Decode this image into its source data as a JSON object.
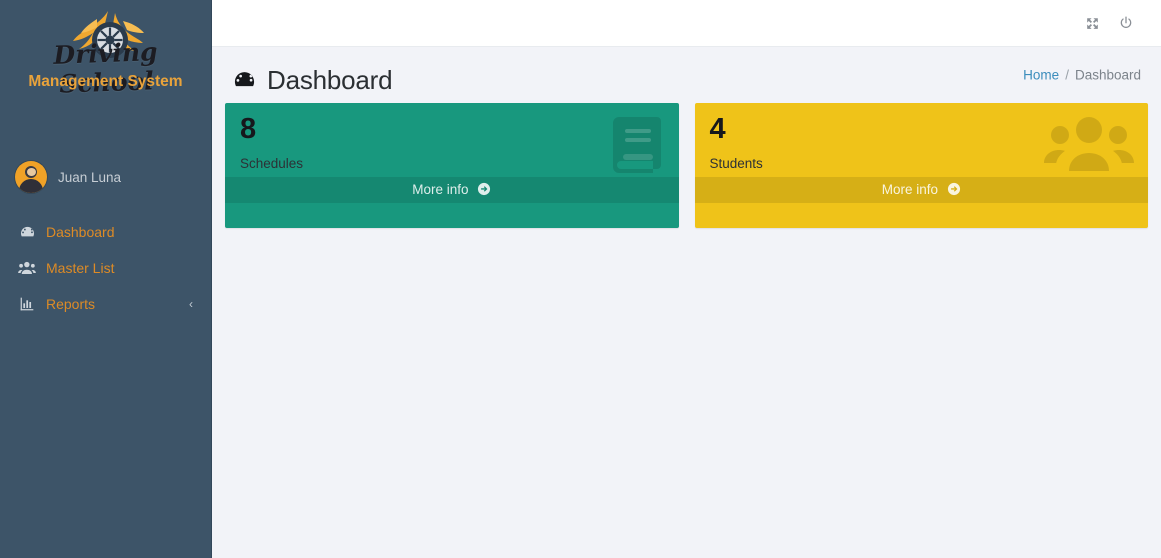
{
  "sidebar": {
    "brand": {
      "script_text": "Driving School",
      "sub_text": "Management System",
      "logo_icon": "flame-wheel-logo-icon"
    },
    "user": {
      "name": "Juan Luna",
      "avatar_icon": "user-avatar"
    },
    "items": [
      {
        "label": "Dashboard",
        "icon": "tachometer-icon",
        "active": true,
        "arrow": ""
      },
      {
        "label": "Master List",
        "icon": "users-icon",
        "active": false,
        "arrow": ""
      },
      {
        "label": "Reports",
        "icon": "chart-bar-icon",
        "active": false,
        "arrow": "‹"
      }
    ],
    "bg_color": "#3d5468",
    "link_color": "#dd8b26"
  },
  "navbar": {
    "buttons": [
      {
        "name": "fullscreen-button",
        "icon": "expand-arrows-icon"
      },
      {
        "name": "logout-button",
        "icon": "power-icon"
      }
    ]
  },
  "header": {
    "title": "Dashboard",
    "title_icon": "tachometer-icon",
    "breadcrumb": {
      "home": "Home",
      "separator": "/",
      "current": "Dashboard"
    }
  },
  "cards": [
    {
      "count": "8",
      "label": "Schedules",
      "footer": "More info",
      "icon": "book-icon",
      "color": "#18987e",
      "theme": "bg-green"
    },
    {
      "count": "4",
      "label": "Students",
      "footer": "More info",
      "icon": "users-group-icon",
      "color": "#efc319",
      "theme": "bg-yellow"
    }
  ]
}
